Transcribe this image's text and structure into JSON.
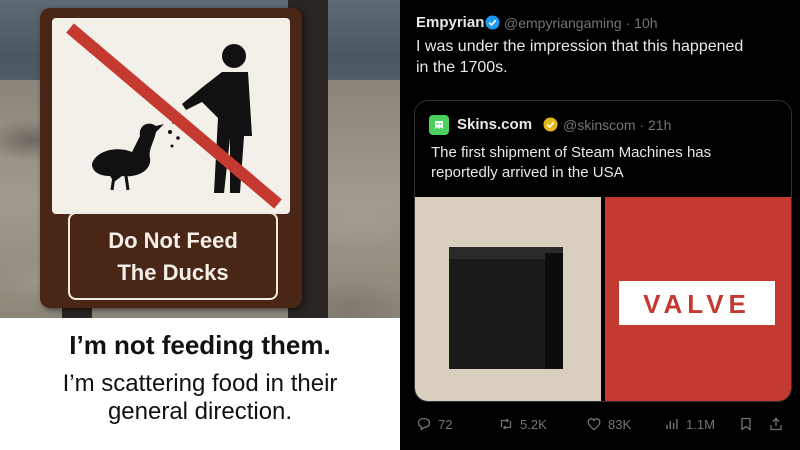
{
  "meme": {
    "sign_line1": "Do Not Feed",
    "sign_line2": "The Ducks",
    "caption_bold": "I’m not feeding them.",
    "caption_line1": "I’m scattering food in their",
    "caption_line2": "general direction."
  },
  "tweet": {
    "name": "Empyrian",
    "handle": "@empyriangaming",
    "time": "· 10h",
    "text_line1": "I was under the impression that this happened",
    "text_line2": "in the 1700s.",
    "quote": {
      "name": "Skins.com",
      "handle": "@skinscom",
      "time": "· 21h",
      "text_line1": "The first shipment of Steam Machines has",
      "text_line2": "reportedly arrived in the USA",
      "image2_text": "VALVE"
    },
    "actions": {
      "replies": "72",
      "retweets": "5.2K",
      "likes": "83K",
      "views": "1.1M"
    }
  },
  "colors": {
    "accent_green": "#4ad15d",
    "valve_red": "#c43a31",
    "sign_brown": "#4a2617",
    "muted": "#71767b",
    "verified_blue": "#1d9bf0",
    "verified_gold": "#e2b719"
  }
}
